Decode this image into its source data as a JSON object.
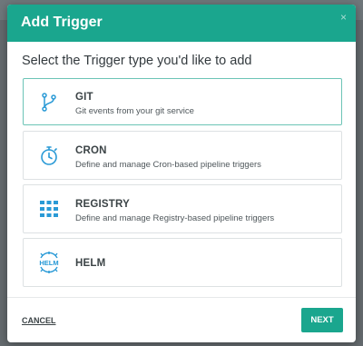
{
  "modal": {
    "title": "Add Trigger",
    "close_glyph": "×",
    "subtitle": "Select the Trigger type you'd like to add"
  },
  "options": [
    {
      "name": "GIT",
      "description": "Git events from your git service",
      "icon": "git-branch-icon",
      "selected": true
    },
    {
      "name": "CRON",
      "description": "Define and manage Cron-based pipeline triggers",
      "icon": "stopwatch-icon",
      "selected": false
    },
    {
      "name": "REGISTRY",
      "description": "Define and manage Registry-based pipeline triggers",
      "icon": "grid-icon",
      "selected": false
    },
    {
      "name": "HELM",
      "description": "",
      "icon": "helm-icon",
      "selected": false
    }
  ],
  "helm_icon_text": "HELM",
  "footer": {
    "cancel_label": "CANCEL",
    "next_label": "NEXT"
  },
  "colors": {
    "accent": "#1aa68e",
    "icon_blue": "#2a9ad6",
    "selected_border": "#6cc4b6"
  }
}
